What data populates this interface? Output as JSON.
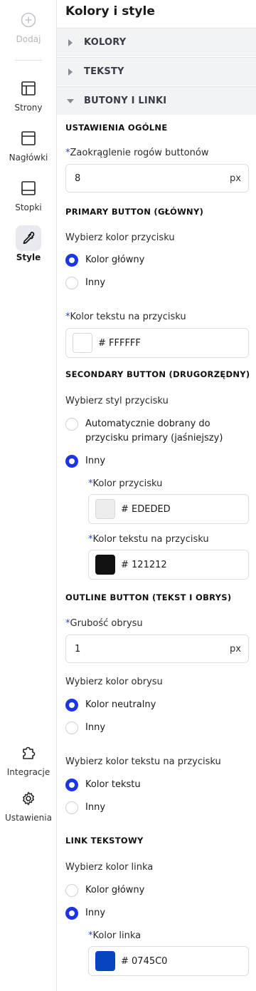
{
  "rail": {
    "add": "Dodaj",
    "pages": "Strony",
    "headers": "Nagłówki",
    "footers": "Stopki",
    "style": "Style",
    "integrations": "Integracje",
    "settings": "Ustawienia"
  },
  "panel": {
    "title": "Kolory i style",
    "accordions": [
      "KOLORY",
      "TEKSTY",
      "BUTONY I LINKI"
    ]
  },
  "general": {
    "heading": "USTAWIENIA OGÓLNE",
    "radius_label": "Zaokrąglenie rogów buttonów",
    "radius_value": "8",
    "unit": "px"
  },
  "primary": {
    "heading": "PRIMARY BUTTON (GŁÓWNY)",
    "choose_label": "Wybierz kolor przycisku",
    "options": [
      "Kolor główny",
      "Inny"
    ],
    "text_color_label": "Kolor tekstu na przycisku",
    "text_color_hex": "# FFFFFF",
    "text_color_swatch": "#FFFFFF"
  },
  "secondary": {
    "heading": "SECONDARY BUTTON (DRUGORZĘDNY)",
    "choose_label": "Wybierz styl przycisku",
    "option_auto": "Automatycznie dobrany do przycisku primary (jaśniejszy)",
    "option_other": "Inny",
    "button_color_label": "Kolor przycisku",
    "button_color_hex": "# EDEDED",
    "button_color_swatch": "#EDEDED",
    "text_color_label": "Kolor tekstu na przycisku",
    "text_color_hex": "# 121212",
    "text_color_swatch": "#121212"
  },
  "outline": {
    "heading": "OUTLINE BUTTON (TEKST I OBRYS)",
    "thickness_label": "Grubość obrysu",
    "thickness_value": "1",
    "unit": "px",
    "outline_color_label": "Wybierz kolor obrysu",
    "outline_options": [
      "Kolor neutralny",
      "Inny"
    ],
    "text_color_label": "Wybierz kolor tekstu na przycisku",
    "text_options": [
      "Kolor tekstu",
      "Inny"
    ]
  },
  "link": {
    "heading": "LINK TEKSTOWY",
    "choose_label": "Wybierz kolor linka",
    "options": [
      "Kolor główny",
      "Inny"
    ],
    "color_label": "Kolor linka",
    "color_hex": "# 0745C0",
    "color_swatch": "#0745C0"
  },
  "colors": {
    "accent": "#1D35E6",
    "required": "#2B3FD6"
  }
}
